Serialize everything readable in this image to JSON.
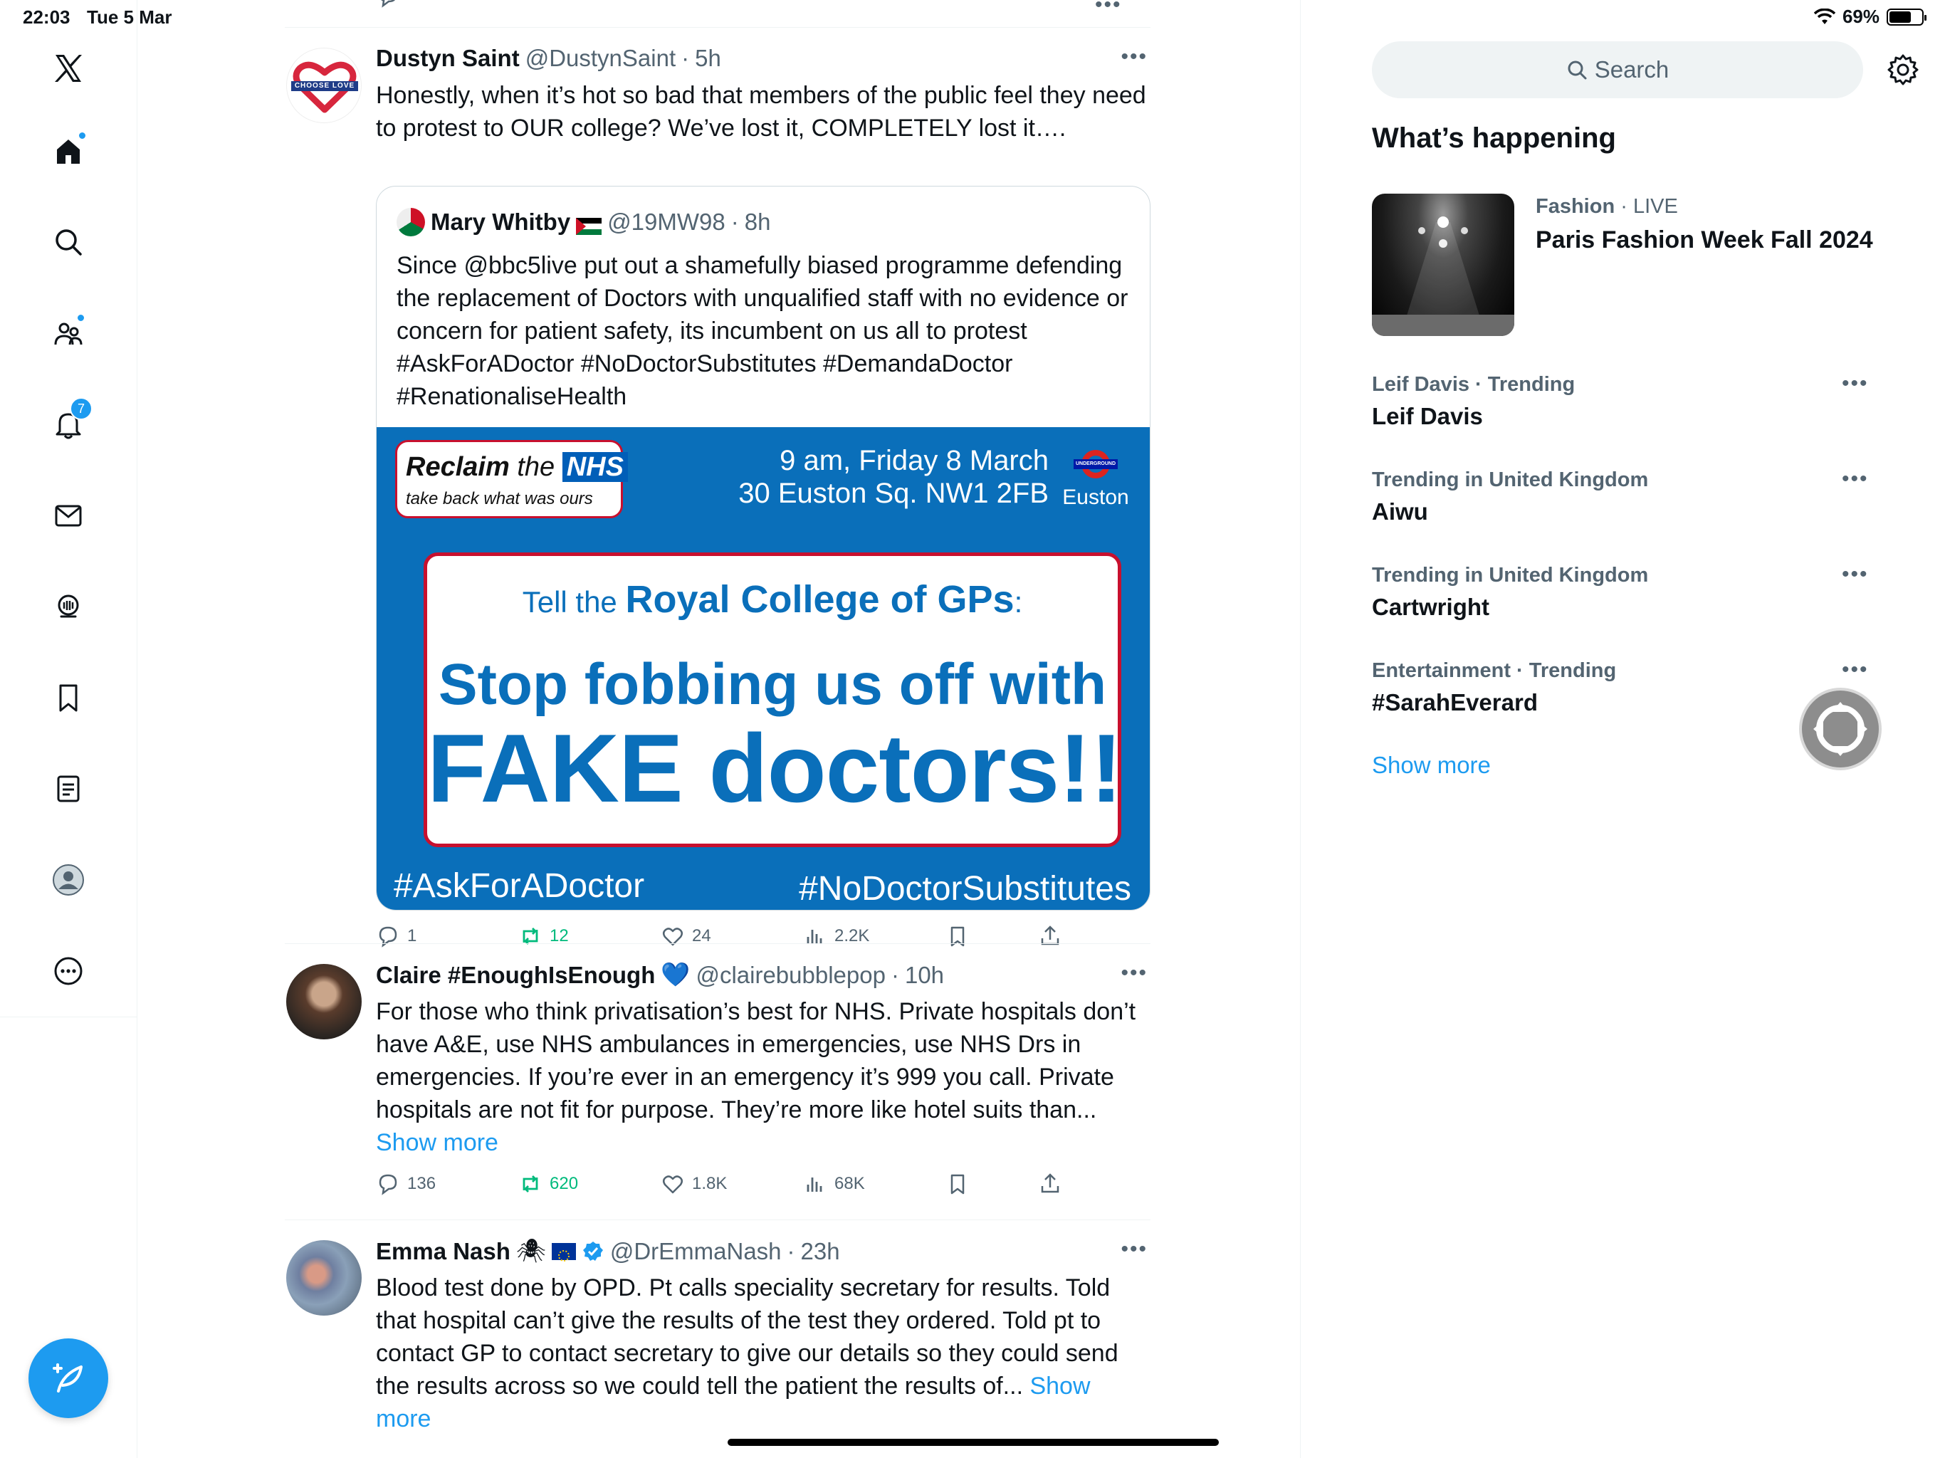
{
  "status_bar": {
    "time": "22:03",
    "date": "Tue 5 Mar",
    "battery": "69%"
  },
  "nav": {
    "notification_count": "7"
  },
  "tweets": [
    {
      "name": "Dustyn Saint",
      "handle": "@DustynSaint",
      "dot": "·",
      "time": "5h",
      "text": "Honestly, when it’s hot so bad that members of the public feel they need to protest to OUR college? We’ve lost it, COMPLETELY lost it….",
      "avatar_label": "CHOOSE LOVE",
      "quote": {
        "name": "Mary Whitby",
        "handle": "@19MW98",
        "dot": "·",
        "time": "8h",
        "text": "Since @bbc5live  put out a shamefully biased programme defending the replacement of Doctors with unqualified staff with no evidence or concern for patient safety, its incumbent on us all to protest #AskForADoctor #NoDoctorSubstitutes #DemandaDoctor #RenationaliseHealth",
        "poster": {
          "logo_reclaim": "Reclaim",
          "logo_the": "the",
          "logo_nhs": "NHS",
          "logo_sub": "take back what was ours",
          "when": "9 am, Friday 8 March",
          "where": "30 Euston Sq. NW1 2FB",
          "station": "Euston",
          "roundel_text": "UNDERGROUND",
          "tell_prefix": "Tell the ",
          "tell_org": "Royal College of GPs",
          "tell_suffix": ":",
          "headline1": "Stop fobbing us off with",
          "headline2": "FAKE doctors!!",
          "tag_left": "#AskForADoctor",
          "tag_right": "#NoDoctorSubstitutes"
        }
      },
      "stats": {
        "replies": "1",
        "retweets": "12",
        "likes": "24",
        "views": "2.2K"
      }
    },
    {
      "name": "Claire #EnoughIsEnough",
      "emoji": "💙",
      "handle": "@clairebubblepop",
      "dot": "·",
      "time": "10h",
      "text": "For those who think privatisation’s best for NHS. Private hospitals don’t have A&E, use NHS ambulances in emergencies, use NHS Drs in emergencies. If you’re ever in an emergency it’s 999 you call. Private hospitals are not fit for purpose. They’re more like hotel suits than... ",
      "show_more": "Show more",
      "stats": {
        "replies": "136",
        "retweets": "620",
        "likes": "1.8K",
        "views": "68K"
      }
    },
    {
      "name": "Emma Nash",
      "emoji": "🕷",
      "handle": "@DrEmmaNash",
      "dot": "·",
      "time": "23h",
      "text": "Blood test done by OPD. Pt calls speciality secretary for results. Told that hospital can’t give the results of the test they ordered. Told pt to contact GP to contact secretary to give our details so they could send the results across so we could tell the patient the results of... ",
      "show_more": "Show more"
    }
  ],
  "right": {
    "search_placeholder": "Search",
    "title": "What’s happening",
    "featured": {
      "category": "Fashion",
      "dot": "·",
      "status": "LIVE",
      "name": "Paris Fashion Week Fall 2024"
    },
    "trends": [
      {
        "meta": "Leif Davis · Trending",
        "name": "Leif Davis"
      },
      {
        "meta": "Trending in United Kingdom",
        "name": "Aiwu"
      },
      {
        "meta": "Trending in United Kingdom",
        "name": "Cartwright"
      },
      {
        "meta": "Entertainment · Trending",
        "name": "#SarahEverard"
      }
    ],
    "show_more": "Show more"
  },
  "colors": {
    "accent": "#1d9bf0",
    "retweet": "#00ba7c",
    "poster_blue": "#0a6fba",
    "poster_red": "#c8102e"
  }
}
